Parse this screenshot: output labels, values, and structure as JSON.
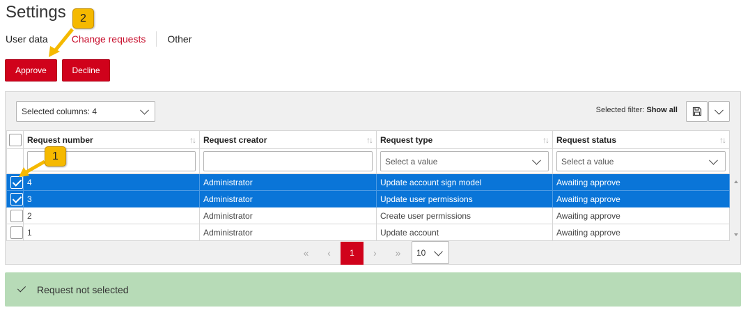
{
  "page": {
    "title": "Settings"
  },
  "tabs": [
    {
      "label": "User data",
      "active": false
    },
    {
      "label": "Change requests",
      "active": true
    },
    {
      "label": "Other",
      "active": false
    }
  ],
  "actions": {
    "approve_label": "Approve",
    "decline_label": "Decline"
  },
  "toolbar": {
    "columns_select": "Selected columns: 4",
    "filter_label": "Selected filter:",
    "filter_value": "Show all",
    "save_icon": "floppy-disk-icon",
    "dropdown_icon": "chevron-down-icon"
  },
  "table": {
    "columns": [
      "Request number",
      "Request creator",
      "Request type",
      "Request status"
    ],
    "filters": {
      "type_placeholder": "Select a value",
      "status_placeholder": "Select a value"
    },
    "rows": [
      {
        "number": "4",
        "creator": "Administrator",
        "type": "Update account sign model",
        "status": "Awaiting approve",
        "selected": true
      },
      {
        "number": "3",
        "creator": "Administrator",
        "type": "Update user permissions",
        "status": "Awaiting approve",
        "selected": true
      },
      {
        "number": "2",
        "creator": "Administrator",
        "type": "Create user permissions",
        "status": "Awaiting approve",
        "selected": false
      },
      {
        "number": "1",
        "creator": "Administrator",
        "type": "Update account",
        "status": "Awaiting approve",
        "selected": false
      }
    ]
  },
  "pager": {
    "first": "«",
    "prev": "‹",
    "current": "1",
    "next": "›",
    "last": "»",
    "page_size": "10"
  },
  "status": {
    "message": "Request not selected",
    "color": "#b7dbb7"
  },
  "annotations": {
    "callout_1": "1",
    "callout_2": "2",
    "color": "#f5b900"
  },
  "colors": {
    "accent": "#d0021b",
    "selection": "#0a75d8"
  }
}
